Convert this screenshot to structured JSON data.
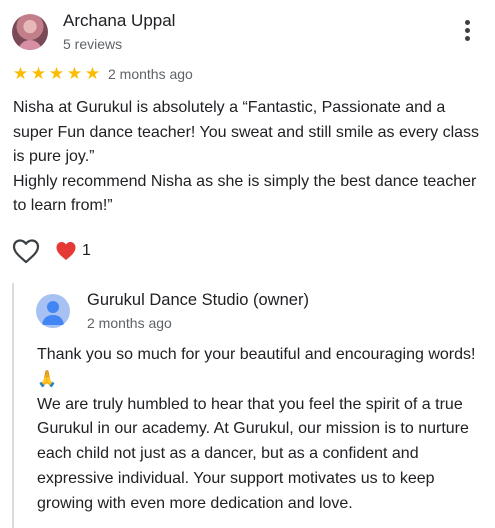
{
  "review": {
    "reviewer_name": "Archana Uppal",
    "reviewer_meta": "5 reviews",
    "rating": 5,
    "stars": [
      "★",
      "★",
      "★",
      "★",
      "★"
    ],
    "time": "2 months ago",
    "text": "Nisha at Gurukul is absolutely a “Fantastic, Passionate and a super Fun dance teacher! You sweat and still smile as every class is pure joy.”\nHighly recommend Nisha as she is simply the best dance teacher to learn from!”",
    "reaction_count": "1"
  },
  "owner_reply": {
    "name": "Gurukul Dance Studio (owner)",
    "time": "2 months ago",
    "text": "Thank you so much for your beautiful and encouraging words! 🙏\nWe are truly humbled to hear that you feel the spirit of a true Gurukul in our academy. At Gurukul, our mission is to nurture each child not just as a dancer, but as a confident and expressive individual. Your support motivates us to keep growing with even more dedication and love."
  },
  "icons": {
    "menu": "more-vert-icon",
    "like": "heart-outline-icon",
    "reaction": "red-heart-icon",
    "owner_avatar": "person-avatar-icon"
  },
  "colors": {
    "star": "#fbbc04",
    "text": "#202124",
    "secondary_text": "#5f6368",
    "heart": "#e53935",
    "divider": "#dadce0",
    "owner_avatar": "#a7c1f2"
  }
}
